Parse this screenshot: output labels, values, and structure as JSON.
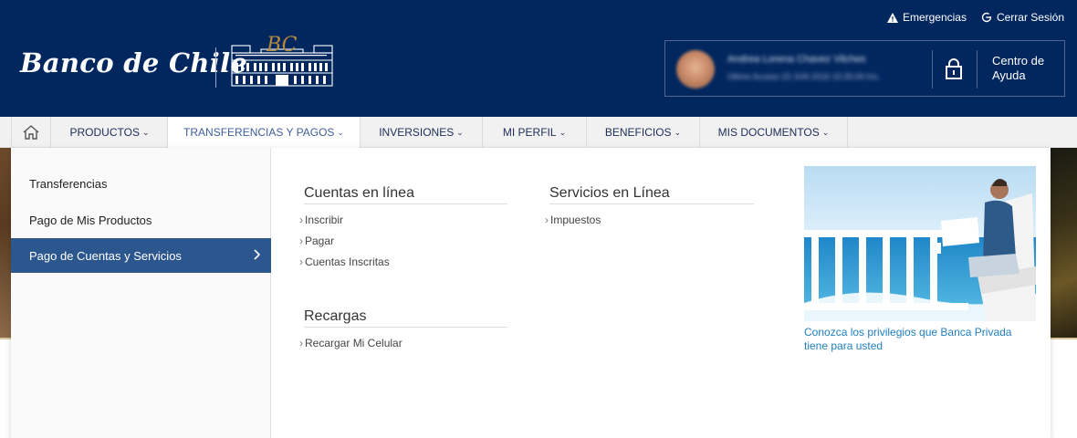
{
  "header": {
    "brand": "Banco de Chile",
    "top_links": [
      {
        "label": "Emergencias",
        "icon": "warning-icon"
      },
      {
        "label": "Cerrar Sesión",
        "icon": "logout-icon"
      }
    ],
    "user": {
      "name": "Andrea Lorena Chavez Vilches",
      "last_access": "Último Acceso 23 JUN 2016 15:25:09 hrs."
    },
    "help": "Centro de Ayuda"
  },
  "nav": {
    "items": [
      {
        "label": "PRODUCTOS"
      },
      {
        "label": "TRANSFERENCIAS Y PAGOS"
      },
      {
        "label": "INVERSIONES"
      },
      {
        "label": "MI PERFIL"
      },
      {
        "label": "BENEFICIOS"
      },
      {
        "label": "MIS DOCUMENTOS"
      }
    ]
  },
  "dropdown": {
    "left_menu": [
      {
        "label": "Transferencias"
      },
      {
        "label": "Pago de Mis Productos"
      },
      {
        "label": "Pago de Cuentas y Servicios"
      }
    ],
    "columns": [
      {
        "title": "Cuentas en línea",
        "links": [
          "Inscribir",
          "Pagar",
          "Cuentas Inscritas"
        ]
      },
      {
        "title": "Servicios en Línea",
        "links": [
          "Impuestos"
        ]
      },
      {
        "title": "Recargas",
        "links": [
          "Recargar Mi Celular"
        ]
      }
    ],
    "promo": {
      "text": "Conozca los privilegios que Banca Privada tiene para usted"
    }
  },
  "colors": {
    "header_bg": "#02275f",
    "active_menu_bg": "#2b568e",
    "promo_link": "#1f7fc0"
  }
}
